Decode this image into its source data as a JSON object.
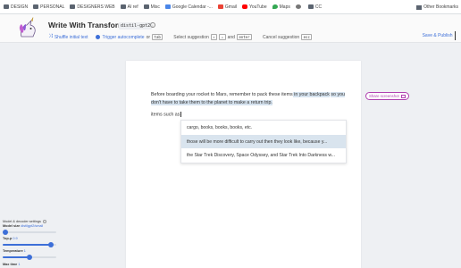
{
  "bookmarks": {
    "items": [
      {
        "label": "DESIGN",
        "icon": "folder-icon"
      },
      {
        "label": "PERSONAL",
        "icon": "folder-icon"
      },
      {
        "label": "DESIGNERS WEB",
        "icon": "folder-icon"
      },
      {
        "label": "AI ref",
        "icon": "folder-icon"
      },
      {
        "label": "Misc",
        "icon": "folder-icon"
      },
      {
        "label": "Google Calendar -...",
        "icon": "calendar-icon"
      },
      {
        "label": "Gmail",
        "icon": "gmail-icon"
      },
      {
        "label": "YouTube",
        "icon": "youtube-icon"
      },
      {
        "label": "Maps",
        "icon": "maps-icon"
      },
      {
        "label": "",
        "icon": "globe-icon"
      },
      {
        "label": "CC",
        "icon": "folder-icon"
      }
    ],
    "other": "Other Bookmarks"
  },
  "header": {
    "title": "Write With Transformer",
    "model": "distil-gpt2",
    "shuffle": "Shuffle initial text",
    "trigger": "Trigger autocomplete",
    "or": "or",
    "tab_key": "tab",
    "select_label": "Select suggestion",
    "up_key": "↑",
    "down_key": "↓",
    "and": "and",
    "enter_key": "enter",
    "cancel_label": "Cancel suggestion",
    "esc_key": "esc",
    "save": "Save & Publish"
  },
  "editor": {
    "text_plain": "Before boarding your rocket to Mars, remember to pack these items",
    "text_highlight_1": " in your backpack",
    "text_highlight_2": "so you don't have to take them to the planet to make a return trip.",
    "second_line": "items such as"
  },
  "share": "Share screenshot",
  "suggestions": [
    "cargo, books, books, books, etc.",
    "those will be more difficult to carry out then they look like, because y...",
    "the Star Trek Discovery, Space Odyssey, and Star Trek Into Darkness w..."
  ],
  "suggestion_selected_index": 1,
  "settings": {
    "title": "Model & decoder settings",
    "model_size_label": "Model size",
    "model_size_value": "distilgpt2/small",
    "top_p_label": "Top-p",
    "top_p_value": "0.9",
    "top_p_fraction": 0.9,
    "temperature_label": "Temperature",
    "temperature_value": "1",
    "temperature_fraction": 0.5,
    "model_size_fraction": 0.0,
    "max_time_label": "Max time",
    "max_time_value": "1"
  },
  "colors": {
    "accent": "#3d6fd8",
    "highlight": "#d6e3ef",
    "share": "#b040b0"
  }
}
